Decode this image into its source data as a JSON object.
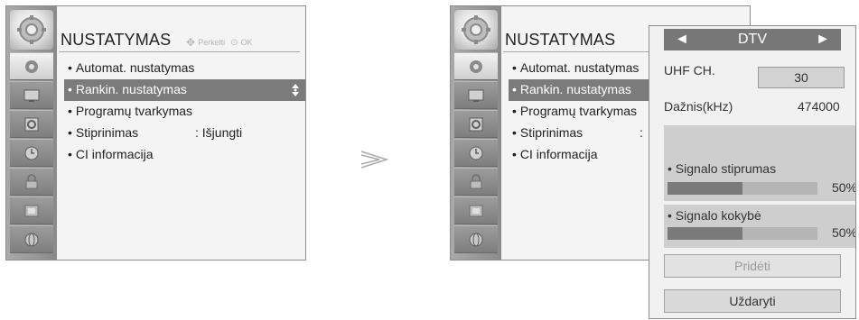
{
  "left_menu": {
    "title": "NUSTATYMAS",
    "hint_move": "Perkelti",
    "hint_ok": "OK",
    "items": [
      {
        "label": "Automat. nustatymas",
        "value": ""
      },
      {
        "label": "Rankin. nustatymas",
        "value": ""
      },
      {
        "label": "Programų tvarkymas",
        "value": ""
      },
      {
        "label": "Stiprinimas",
        "value": ": Išjungti"
      },
      {
        "label": "CI informacija",
        "value": ""
      }
    ],
    "selected_index": 1,
    "icons": [
      "gear-icon",
      "satellite-dish-icon",
      "monitor-icon",
      "speaker-icon",
      "clock-icon",
      "lock-icon",
      "screen-option-icon",
      "globe-icon"
    ]
  },
  "right_menu": {
    "title": "NUSTATYMAS",
    "items": [
      {
        "label": "Automat. nustatymas",
        "value": ""
      },
      {
        "label": "Rankin. nustatymas",
        "value": ""
      },
      {
        "label": "Programų tvarkymas",
        "value": ""
      },
      {
        "label": "Stiprinimas",
        "value": ":"
      },
      {
        "label": "CI informacija",
        "value": ""
      }
    ],
    "selected_index": 1
  },
  "arrow_symbol": "≫",
  "popup": {
    "mode": "DTV",
    "prev_symbol": "◄",
    "next_symbol": "►",
    "uhf_label": "UHF CH.",
    "uhf_value": "30",
    "freq_label": "Dažnis(kHz)",
    "freq_value": "474000",
    "signal_strength_label": "Signalo stiprumas",
    "signal_strength_pct": "50%",
    "signal_strength_value": 0.5,
    "signal_quality_label": "Signalo kokybė",
    "signal_quality_pct": "50%",
    "signal_quality_value": 0.5,
    "add_button": "Pridėti",
    "close_button": "Uždaryti"
  },
  "colors": {
    "selection": "#7b7b7b",
    "popup_header": "#777777",
    "bar_fill": "#7a7a7a"
  }
}
